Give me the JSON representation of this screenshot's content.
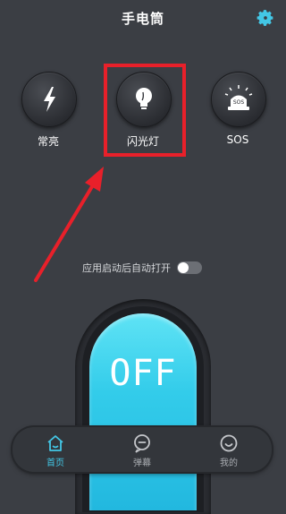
{
  "header": {
    "title": "手电筒",
    "settings_icon": "gear-icon"
  },
  "modes": [
    {
      "label": "常亮",
      "icon": "lightning-icon"
    },
    {
      "label": "闪光灯",
      "icon": "bulb-icon",
      "highlighted": true
    },
    {
      "label": "SOS",
      "icon": "sos-siren-icon"
    }
  ],
  "auto_open": {
    "label": "应用启动后自动打开",
    "enabled": false
  },
  "power_switch": {
    "label": "OFF",
    "color": "#33ccea"
  },
  "tabs": [
    {
      "label": "首页",
      "icon": "home-icon",
      "active": true
    },
    {
      "label": "弹幕",
      "icon": "message-icon",
      "active": false
    },
    {
      "label": "我的",
      "icon": "profile-icon",
      "active": false
    }
  ],
  "colors": {
    "background": "#3b3e44",
    "accent": "#43c7e6",
    "highlight": "#e8202a"
  }
}
